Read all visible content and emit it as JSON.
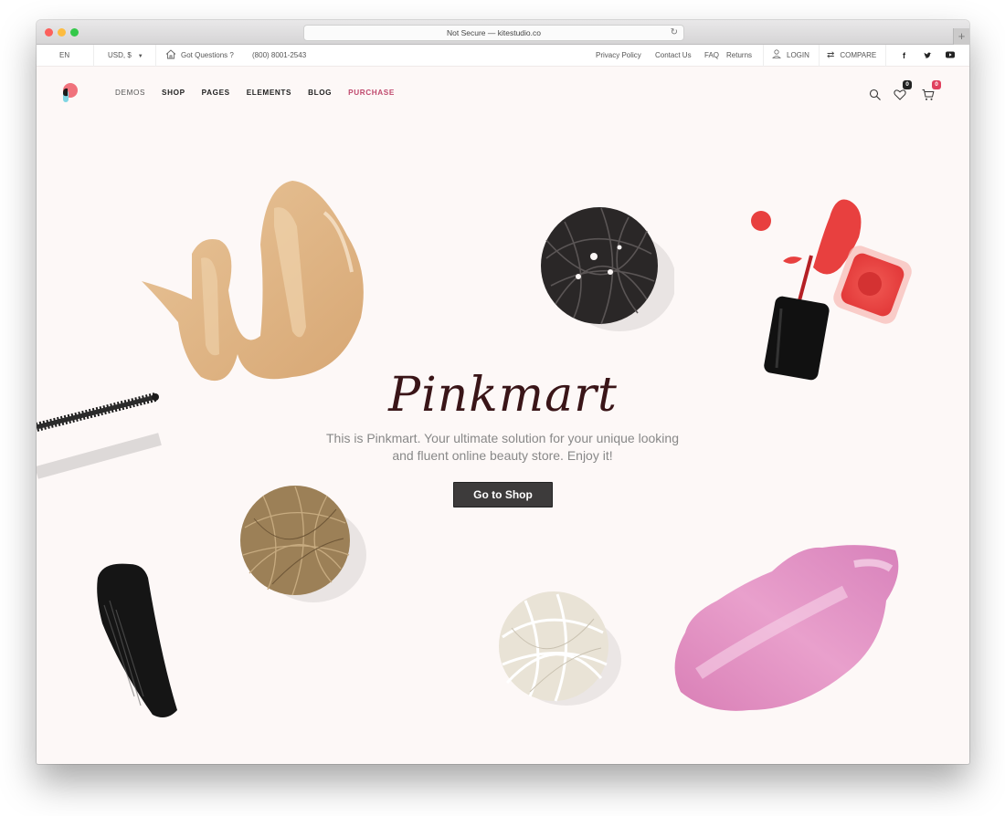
{
  "browser": {
    "url_text": "Not Secure — kitestudio.co",
    "reload_icon": "reload-icon",
    "new_tab_label": "+"
  },
  "topbar": {
    "language": "EN",
    "currency": "USD, $",
    "questions_label": "Got Questions ?",
    "phone": "(800) 8001-2543",
    "links": [
      "Privacy Policy",
      "Contact Us",
      "FAQ",
      "Returns"
    ],
    "login_label": "LOGIN",
    "compare_label": "COMPARE",
    "social": [
      "facebook-icon",
      "twitter-icon",
      "youtube-icon"
    ]
  },
  "nav": {
    "items": [
      {
        "label": "DEMOS"
      },
      {
        "label": "SHOP"
      },
      {
        "label": "PAGES"
      },
      {
        "label": "ELEMENTS"
      },
      {
        "label": "BLOG"
      },
      {
        "label": "PURCHASE"
      }
    ],
    "wishlist_count": "0",
    "cart_count": "0",
    "colors": {
      "accent": "#c04a6e",
      "wishlist_badge": "#222222",
      "cart_badge": "#e0405e"
    }
  },
  "hero": {
    "title": "Pinkmart",
    "text": "This is Pinkmart. Your ultimate solution for your unique looking and fluent online beauty store. Enjoy it!",
    "button_label": "Go to Shop"
  }
}
